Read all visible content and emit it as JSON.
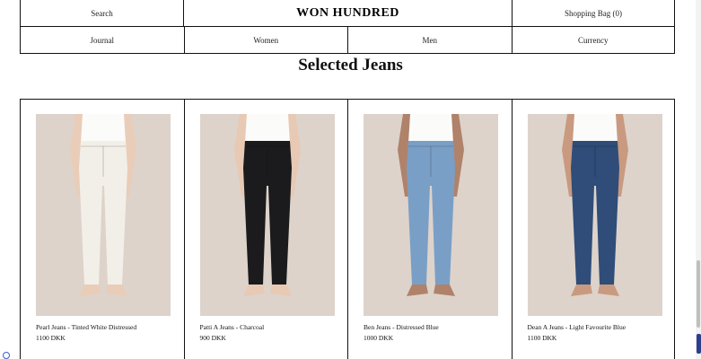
{
  "header": {
    "search_label": "Search",
    "brand": "WON HUNDRED",
    "bag_label": "Shopping Bag (0)"
  },
  "nav": {
    "items": [
      {
        "label": "Journal"
      },
      {
        "label": "Women"
      },
      {
        "label": "Men"
      },
      {
        "label": "Currency"
      }
    ]
  },
  "section": {
    "title": "Selected Jeans"
  },
  "products": [
    {
      "name": "Pearl Jeans - Tinted White Distressed",
      "price": "1100 DKK",
      "denim_color": "#f2efe8",
      "skin": "#e9cdb8",
      "icon": "product-photo"
    },
    {
      "name": "Patti A Jeans - Charcoal",
      "price": "900 DKK",
      "denim_color": "#1b1b1d",
      "skin": "#e7c9b4",
      "icon": "product-photo"
    },
    {
      "name": "Ben Jeans - Distressed Blue",
      "price": "1000 DKK",
      "denim_color": "#7a9fc6",
      "skin": "#b0826a",
      "icon": "product-photo"
    },
    {
      "name": "Dean A Jeans - Light Favourite Blue",
      "price": "1100 DKK",
      "denim_color": "#2f4d78",
      "skin": "#c99a80",
      "icon": "product-photo"
    }
  ],
  "colors": {
    "background": "#ffffff",
    "border": "#111111",
    "photo_bg": "#ddd3cb"
  }
}
